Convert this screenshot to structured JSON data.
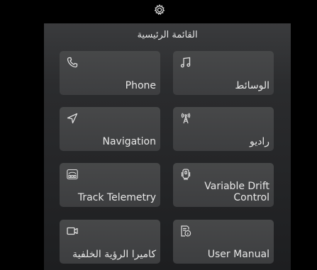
{
  "header": {
    "settings_icon": "gear-icon"
  },
  "menu": {
    "title": "القائمة الرئيسية",
    "tiles": [
      {
        "id": "phone",
        "label": "Phone",
        "icon": "phone-icon"
      },
      {
        "id": "media",
        "label": "الوسائط",
        "icon": "music-note-icon"
      },
      {
        "id": "navigation",
        "label": "Navigation",
        "icon": "navigation-arrow-icon"
      },
      {
        "id": "radio",
        "label": "راديو",
        "icon": "radio-tower-icon"
      },
      {
        "id": "telemetry",
        "label": "Track Telemetry",
        "icon": "telemetry-gauge-icon"
      },
      {
        "id": "drift",
        "label": "Variable Drift\nControl",
        "icon": "drift-control-icon"
      },
      {
        "id": "camera",
        "label": "كاميرا الرؤية الخلفية",
        "icon": "camera-icon"
      },
      {
        "id": "manual",
        "label": "User Manual",
        "icon": "manual-info-icon"
      }
    ]
  },
  "colors": {
    "background": "#000000",
    "panel_top": "#3a3b3d",
    "tile": "#434446",
    "text": "#e8e8e8"
  }
}
